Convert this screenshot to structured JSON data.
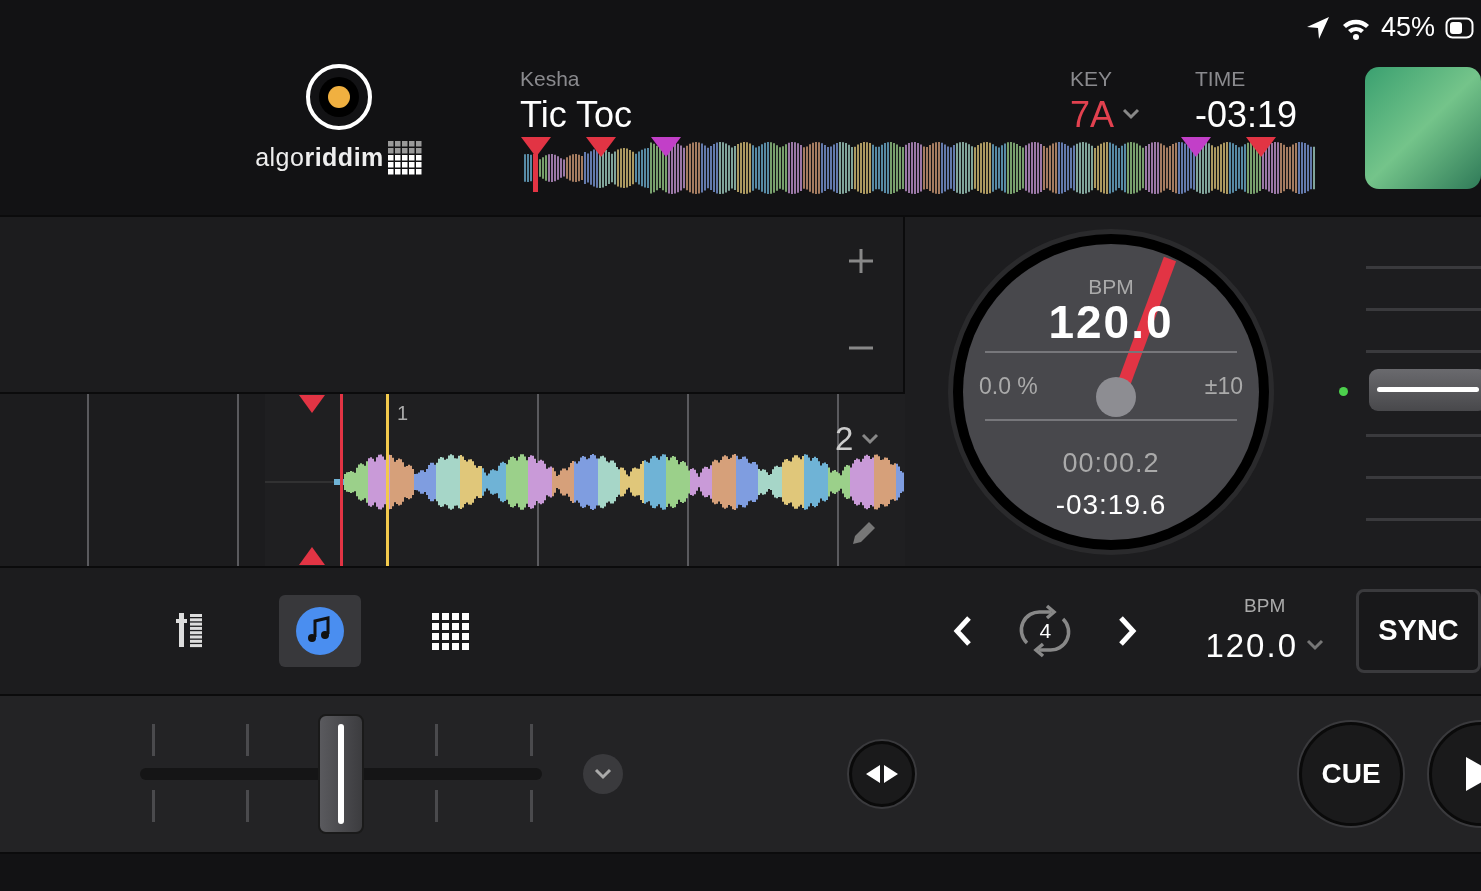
{
  "status_bar": {
    "battery": "45%"
  },
  "header": {
    "logo": "algo**riddim**",
    "artist": "Kesha",
    "title": "Tic Toc",
    "key_label": "KEY",
    "key": "7A",
    "time_label": "TIME",
    "time": "-03:19",
    "overview_markers": [
      {
        "color": "#e23444"
      },
      {
        "color": "#e23444"
      },
      {
        "color": "#c23fc8"
      },
      {
        "color": "#c23fc8"
      },
      {
        "color": "#e23444"
      }
    ]
  },
  "waveform": {
    "beat_label": "1",
    "zoom": "2"
  },
  "platter": {
    "bpm_label": "BPM",
    "bpm": "120.0",
    "pitch": "0.0 %",
    "range": "±10",
    "elapsed": "00:00.2",
    "remaining": "-03:19.6"
  },
  "pitch_fader": {
    "level": 0.5
  },
  "toolbar": {
    "tabs": [
      {
        "kind": "mixer",
        "selected": false
      },
      {
        "kind": "music",
        "selected": true
      },
      {
        "kind": "pads",
        "selected": false
      }
    ],
    "loop": "4",
    "bpm_label": "BPM",
    "bpm": "120.0",
    "sync": "SYNC"
  },
  "transport": {
    "fader": {
      "level": 0.5
    },
    "cue": "CUE"
  }
}
